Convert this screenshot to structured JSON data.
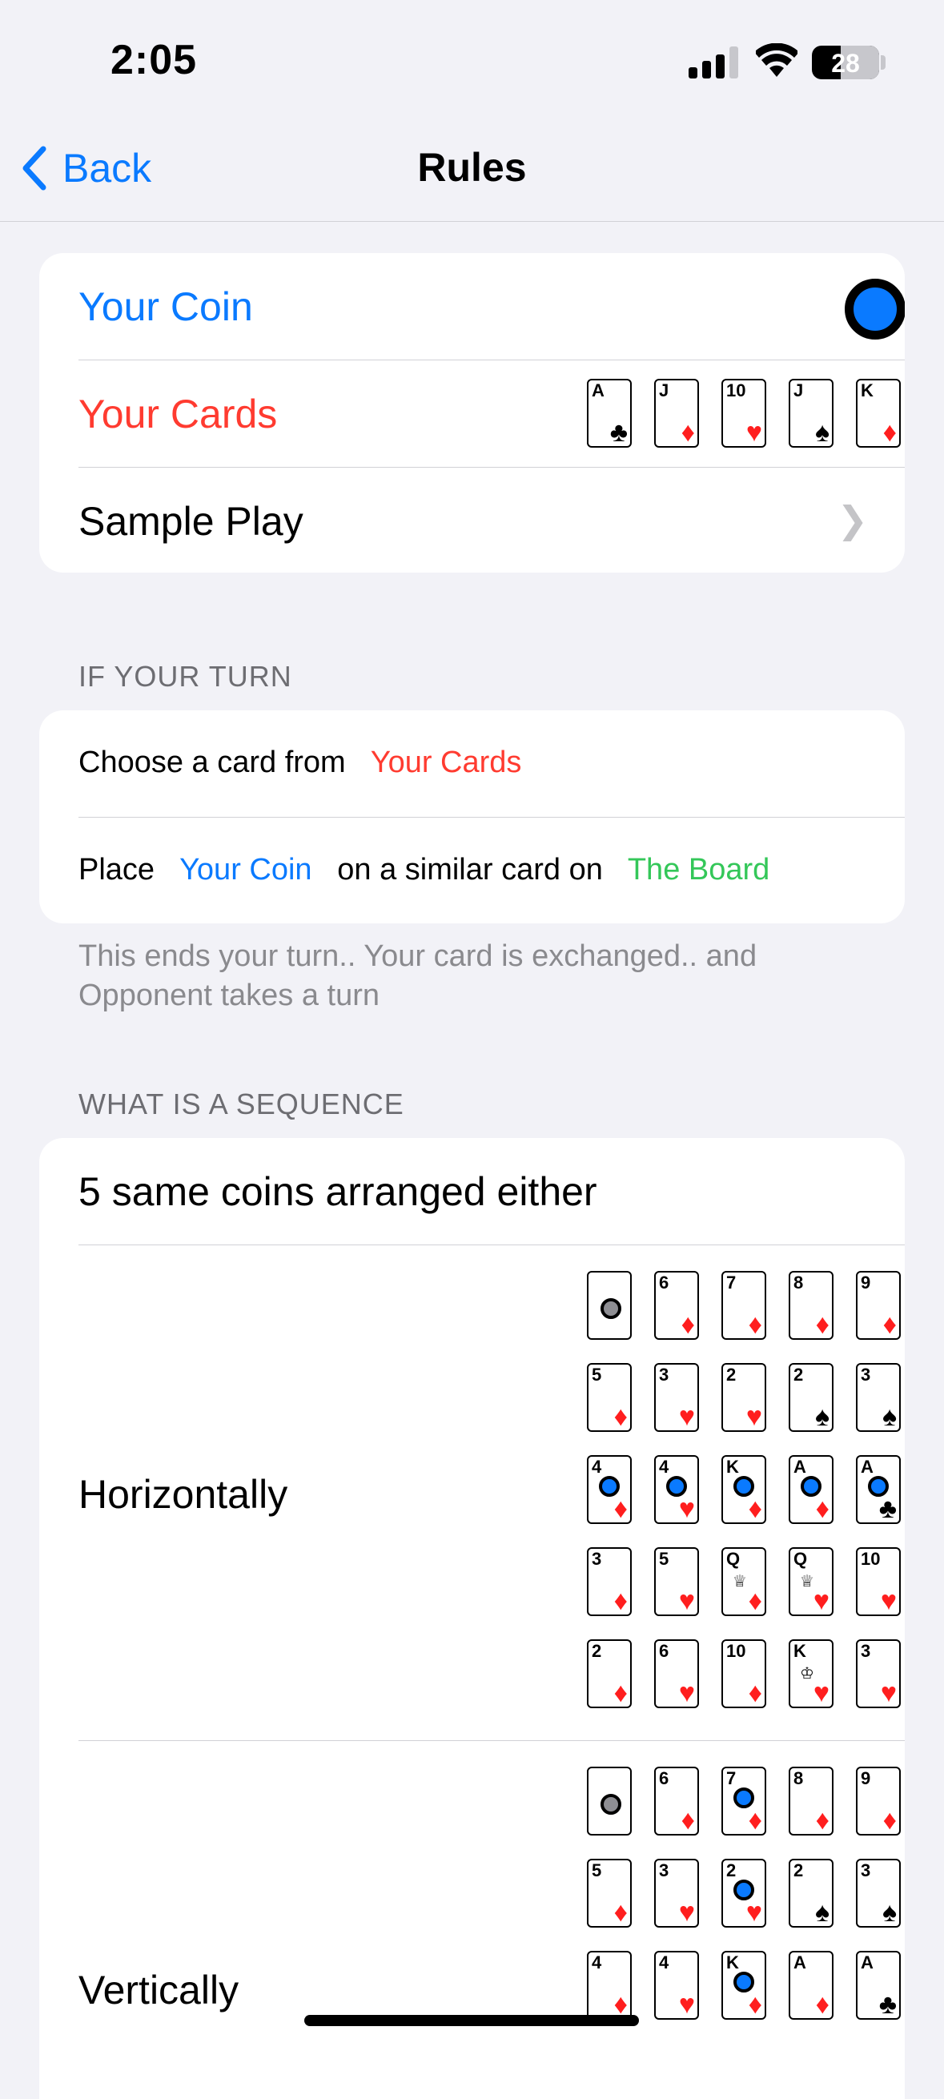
{
  "status": {
    "time": "2:05",
    "battery": "28"
  },
  "nav": {
    "back": "Back",
    "title": "Rules"
  },
  "settings": {
    "coin_label": "Your Coin",
    "cards_label": "Your Cards",
    "sample_label": "Sample Play"
  },
  "your_cards": [
    {
      "rank": "A",
      "suit": "♣",
      "color": "black"
    },
    {
      "rank": "J",
      "suit": "♦",
      "color": "red"
    },
    {
      "rank": "10",
      "suit": "♥",
      "color": "red"
    },
    {
      "rank": "J",
      "suit": "♠",
      "color": "black"
    },
    {
      "rank": "K",
      "suit": "♦",
      "color": "red"
    }
  ],
  "turn": {
    "header": "IF YOUR TURN",
    "row1": {
      "text": "Choose a card from",
      "highlight": "Your Cards"
    },
    "row2": {
      "pre": "Place",
      "coin": "Your Coin",
      "mid": "on a similar card on",
      "board": "The Board"
    },
    "footer": "This ends your turn.. Your card is exchanged.. and Opponent takes a turn"
  },
  "sequence": {
    "header": "WHAT IS A SEQUENCE",
    "intro": "5 same coins arranged either",
    "horizontal_label": "Horizontally",
    "vertical_label": "Vertically",
    "horizontal_grid": [
      [
        {
          "rank": "",
          "suit": "",
          "color": "",
          "coin": "gray"
        },
        {
          "rank": "6",
          "suit": "♦",
          "color": "red"
        },
        {
          "rank": "7",
          "suit": "♦",
          "color": "red"
        },
        {
          "rank": "8",
          "suit": "♦",
          "color": "red"
        },
        {
          "rank": "9",
          "suit": "♦",
          "color": "red"
        }
      ],
      [
        {
          "rank": "5",
          "suit": "♦",
          "color": "red"
        },
        {
          "rank": "3",
          "suit": "♥",
          "color": "red"
        },
        {
          "rank": "2",
          "suit": "♥",
          "color": "red"
        },
        {
          "rank": "2",
          "suit": "♠",
          "color": "black"
        },
        {
          "rank": "3",
          "suit": "♠",
          "color": "black"
        }
      ],
      [
        {
          "rank": "4",
          "suit": "♦",
          "color": "red",
          "coin": "blue"
        },
        {
          "rank": "4",
          "suit": "♥",
          "color": "red",
          "coin": "blue"
        },
        {
          "rank": "K",
          "suit": "♦",
          "color": "red",
          "coin": "blue"
        },
        {
          "rank": "A",
          "suit": "♦",
          "color": "red",
          "coin": "blue"
        },
        {
          "rank": "A",
          "suit": "♣",
          "color": "black",
          "coin": "blue"
        }
      ],
      [
        {
          "rank": "3",
          "suit": "♦",
          "color": "red"
        },
        {
          "rank": "5",
          "suit": "♥",
          "color": "red"
        },
        {
          "rank": "Q",
          "suit": "♦",
          "color": "red",
          "face": "♕"
        },
        {
          "rank": "Q",
          "suit": "♥",
          "color": "red",
          "face": "♕"
        },
        {
          "rank": "10",
          "suit": "♥",
          "color": "red"
        }
      ],
      [
        {
          "rank": "2",
          "suit": "♦",
          "color": "red"
        },
        {
          "rank": "6",
          "suit": "♥",
          "color": "red"
        },
        {
          "rank": "10",
          "suit": "♦",
          "color": "red"
        },
        {
          "rank": "K",
          "suit": "♥",
          "color": "red",
          "face": "♔"
        },
        {
          "rank": "3",
          "suit": "♥",
          "color": "red"
        }
      ]
    ],
    "vertical_grid": [
      [
        {
          "rank": "",
          "suit": "",
          "color": "",
          "coin": "gray"
        },
        {
          "rank": "6",
          "suit": "♦",
          "color": "red"
        },
        {
          "rank": "7",
          "suit": "♦",
          "color": "red",
          "coin": "blue"
        },
        {
          "rank": "8",
          "suit": "♦",
          "color": "red"
        },
        {
          "rank": "9",
          "suit": "♦",
          "color": "red"
        }
      ],
      [
        {
          "rank": "5",
          "suit": "♦",
          "color": "red"
        },
        {
          "rank": "3",
          "suit": "♥",
          "color": "red"
        },
        {
          "rank": "2",
          "suit": "♥",
          "color": "red",
          "coin": "blue"
        },
        {
          "rank": "2",
          "suit": "♠",
          "color": "black"
        },
        {
          "rank": "3",
          "suit": "♠",
          "color": "black"
        }
      ],
      [
        {
          "rank": "4",
          "suit": "♦",
          "color": "red"
        },
        {
          "rank": "4",
          "suit": "♥",
          "color": "red"
        },
        {
          "rank": "K",
          "suit": "♦",
          "color": "red",
          "coin": "blue"
        },
        {
          "rank": "A",
          "suit": "♦",
          "color": "red"
        },
        {
          "rank": "A",
          "suit": "♣",
          "color": "black"
        }
      ]
    ]
  }
}
